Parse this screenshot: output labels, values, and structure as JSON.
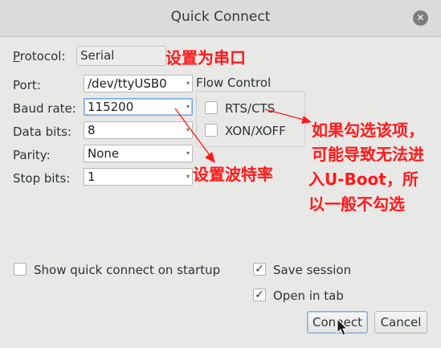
{
  "window": {
    "title": "Quick Connect",
    "close_glyph": "✕"
  },
  "form": {
    "protocol": {
      "label": "Protocol:",
      "value": "Serial"
    },
    "port": {
      "label": "Port:",
      "value": "/dev/ttyUSB0"
    },
    "baud_rate": {
      "label": "Baud rate:",
      "value": "115200"
    },
    "data_bits": {
      "label": "Data bits:",
      "value": "8"
    },
    "parity": {
      "label": "Parity:",
      "value": "None"
    },
    "stop_bits": {
      "label": "Stop bits:",
      "value": "1"
    }
  },
  "flow_control": {
    "heading": "Flow Control",
    "rts_cts": {
      "label": "RTS/CTS",
      "checked": false
    },
    "xon_xoff": {
      "label": "XON/XOFF",
      "checked": false
    }
  },
  "options": {
    "show_on_startup": {
      "label": "Show quick connect on startup",
      "checked": false
    },
    "save_session": {
      "label": "Save session",
      "checked": true
    },
    "open_in_tab": {
      "label": "Open in tab",
      "checked": true
    }
  },
  "buttons": {
    "connect": "Connect",
    "cancel": "Cancel"
  },
  "annotations": {
    "serial": "设置为串口",
    "baud": "设置波特率",
    "flow_1": "如果勾选该项，",
    "flow_2": "可能导致无法进",
    "flow_3": "入U-Boot，所",
    "flow_4": "以一般不勾选",
    "color": "#ff1a1a"
  },
  "icons": {
    "dropdown": "▾",
    "check": "✓"
  }
}
